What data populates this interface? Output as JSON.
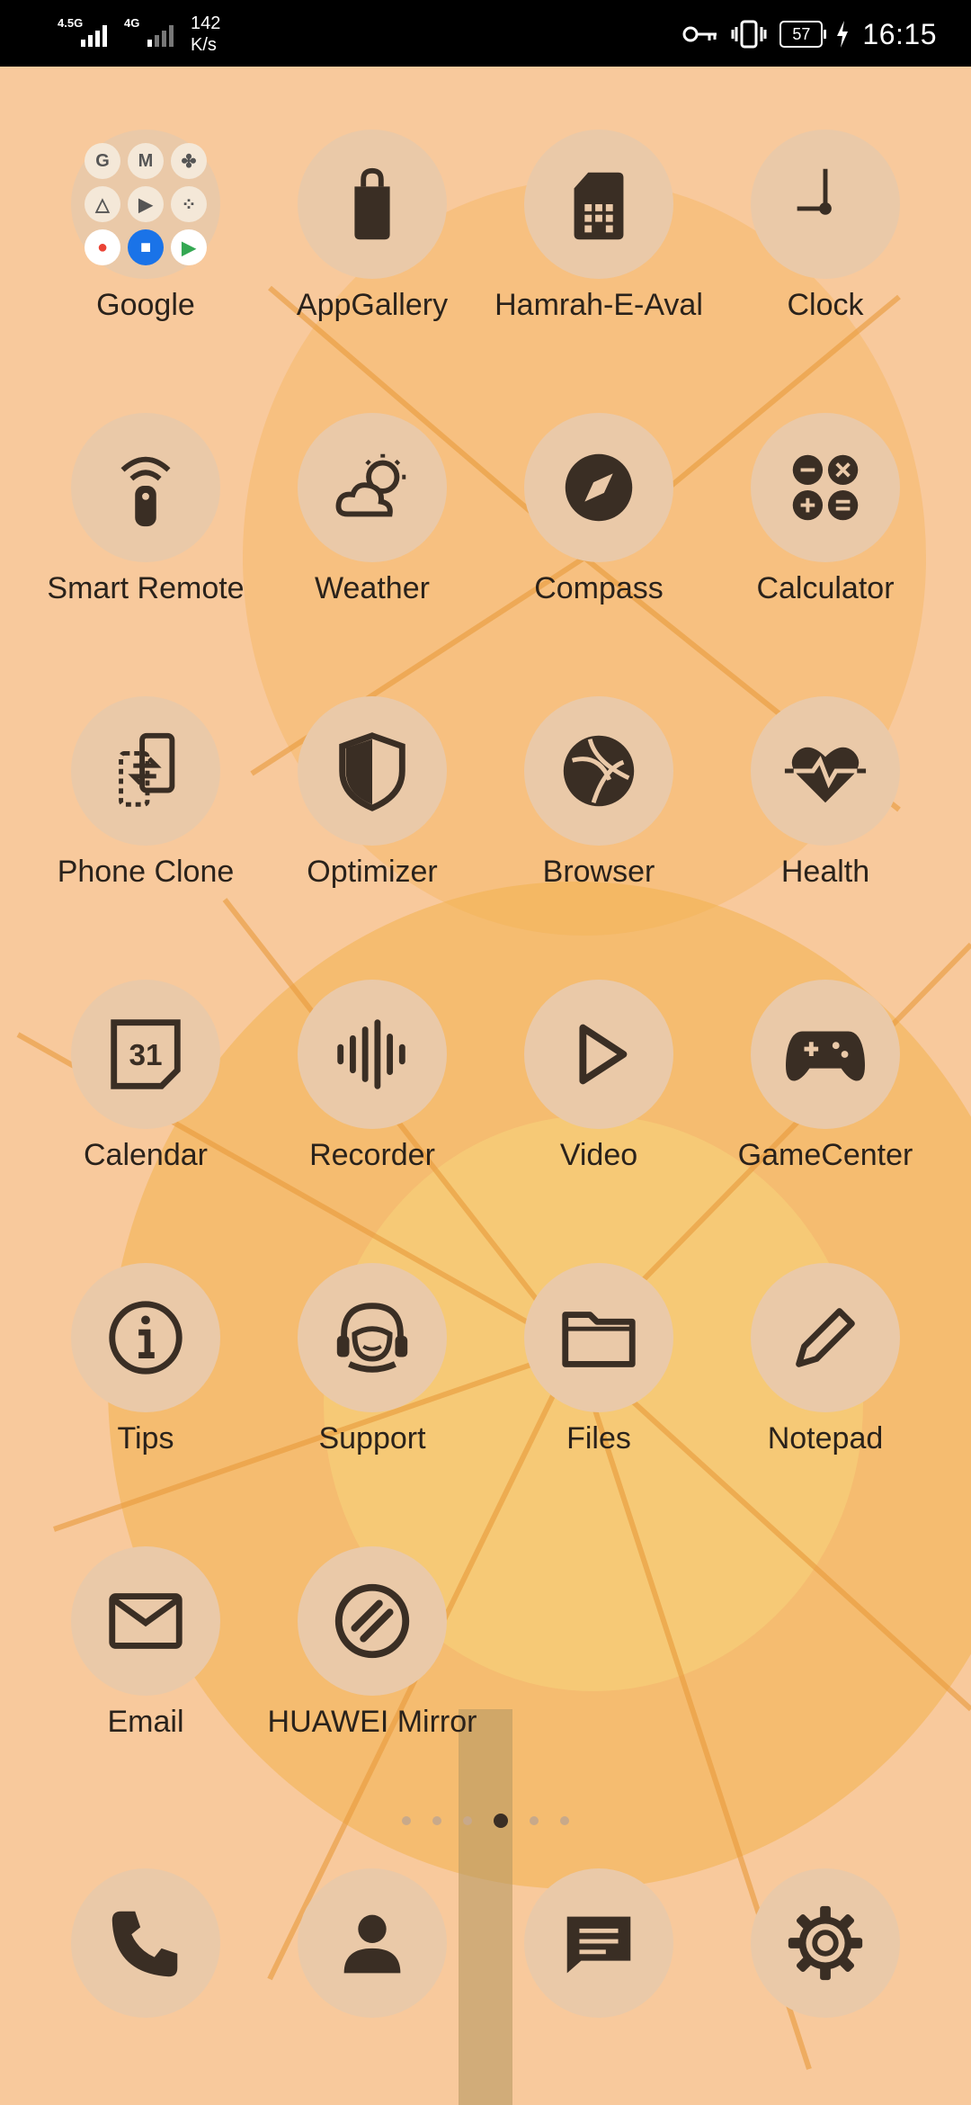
{
  "status_bar": {
    "network_1": "4.5G",
    "network_2": "4G",
    "speed_value": "142",
    "speed_unit": "K/s",
    "battery": "57",
    "time": "16:15"
  },
  "apps": [
    {
      "label": "Google",
      "icon": "google-folder"
    },
    {
      "label": "AppGallery",
      "icon": "shopping-bag-icon"
    },
    {
      "label": "Hamrah-E-Aval",
      "icon": "sim-card-icon"
    },
    {
      "label": "Clock",
      "icon": "clock-icon"
    },
    {
      "label": "Smart Remote",
      "icon": "remote-icon"
    },
    {
      "label": "Weather",
      "icon": "weather-icon"
    },
    {
      "label": "Compass",
      "icon": "compass-icon"
    },
    {
      "label": "Calculator",
      "icon": "calculator-icon"
    },
    {
      "label": "Phone Clone",
      "icon": "phone-clone-icon"
    },
    {
      "label": "Optimizer",
      "icon": "shield-icon"
    },
    {
      "label": "Browser",
      "icon": "browser-icon"
    },
    {
      "label": "Health",
      "icon": "heart-pulse-icon"
    },
    {
      "label": "Calendar",
      "icon": "calendar-icon",
      "icon_text": "31"
    },
    {
      "label": "Recorder",
      "icon": "waveform-icon"
    },
    {
      "label": "Video",
      "icon": "play-icon"
    },
    {
      "label": "GameCenter",
      "icon": "gamepad-icon"
    },
    {
      "label": "Tips",
      "icon": "info-icon"
    },
    {
      "label": "Support",
      "icon": "headset-icon"
    },
    {
      "label": "Files",
      "icon": "folder-icon"
    },
    {
      "label": "Notepad",
      "icon": "pencil-icon"
    },
    {
      "label": "Email",
      "icon": "mail-icon"
    },
    {
      "label": "HUAWEI Mirror",
      "icon": "mirror-icon"
    }
  ],
  "folder_icons": [
    "G",
    "M",
    "✤",
    "△",
    "▶",
    "⁘",
    "●",
    "■",
    "▶"
  ],
  "page_indicator": {
    "count": 6,
    "active_index": 3
  },
  "dock": [
    {
      "icon": "phone-icon"
    },
    {
      "icon": "contacts-icon"
    },
    {
      "icon": "messages-icon"
    },
    {
      "icon": "settings-icon"
    }
  ],
  "colors": {
    "accent": "#3a2e24",
    "icon_bg": "#eac9a8",
    "wallpaper": "#f7caa0"
  }
}
